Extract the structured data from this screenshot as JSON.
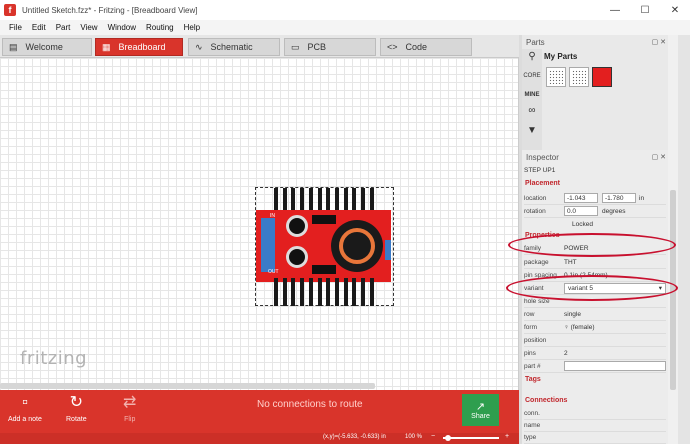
{
  "window": {
    "title": "Untitled Sketch.fzz* - Fritzing - [Breadboard View]",
    "app_icon": "f"
  },
  "menu": [
    "File",
    "Edit",
    "Part",
    "View",
    "Window",
    "Routing",
    "Help"
  ],
  "tabs": [
    {
      "label": "Welcome",
      "icon": "monitor-icon",
      "active": false
    },
    {
      "label": "Breadboard",
      "icon": "breadboard-icon",
      "active": true
    },
    {
      "label": "Schematic",
      "icon": "schematic-icon",
      "active": false
    },
    {
      "label": "PCB",
      "icon": "pcb-icon",
      "active": false
    },
    {
      "label": "Code",
      "icon": "code-icon",
      "active": false
    }
  ],
  "canvas": {
    "logo": "fritzing",
    "part_pin_labels": [
      "IN",
      "OUT"
    ]
  },
  "toolbar": {
    "add_note": "Add a note",
    "rotate": "Rotate",
    "flip": "Flip",
    "connections_msg": "No connections to route",
    "share": "Share"
  },
  "status": {
    "coords": "(x,y)=(-5.633, -0.633) in",
    "zoom": "100 %"
  },
  "parts": {
    "title": "Parts",
    "core_label": "CORE",
    "mine_label": "MINE",
    "bin_title": "My Parts"
  },
  "inspector": {
    "title": "Inspector",
    "part_title": "STEP UP1",
    "placement_header": "Placement",
    "location_label": "location",
    "location_x": "-1.043",
    "location_y": "-1.780",
    "location_unit": "in",
    "rotation_label": "rotation",
    "rotation_value": "0.0",
    "rotation_unit": "degrees",
    "locked_label": "Locked",
    "properties_header": "Properties",
    "family_label": "family",
    "family_value": "POWER",
    "package_label": "package",
    "package_value": "THT",
    "pin_spacing_label": "pin spacing",
    "pin_spacing_value": "0.1in (2.54mm)",
    "variant_label": "variant",
    "variant_value": "variant 5",
    "hole_size_label": "hole size",
    "row_label": "row",
    "row_value": "single",
    "form_label": "form",
    "form_value": "♀ (female)",
    "position_label": "position",
    "pins_label": "pins",
    "pins_value": "2",
    "part_no_label": "part #",
    "tags_header": "Tags",
    "connections_header": "Connections",
    "conn_label": "conn.",
    "name_label": "name",
    "type_label": "type"
  },
  "colors": {
    "accent_red": "#d9342b",
    "share_green": "#2e9e4e",
    "annotation_red": "#c8102e"
  }
}
